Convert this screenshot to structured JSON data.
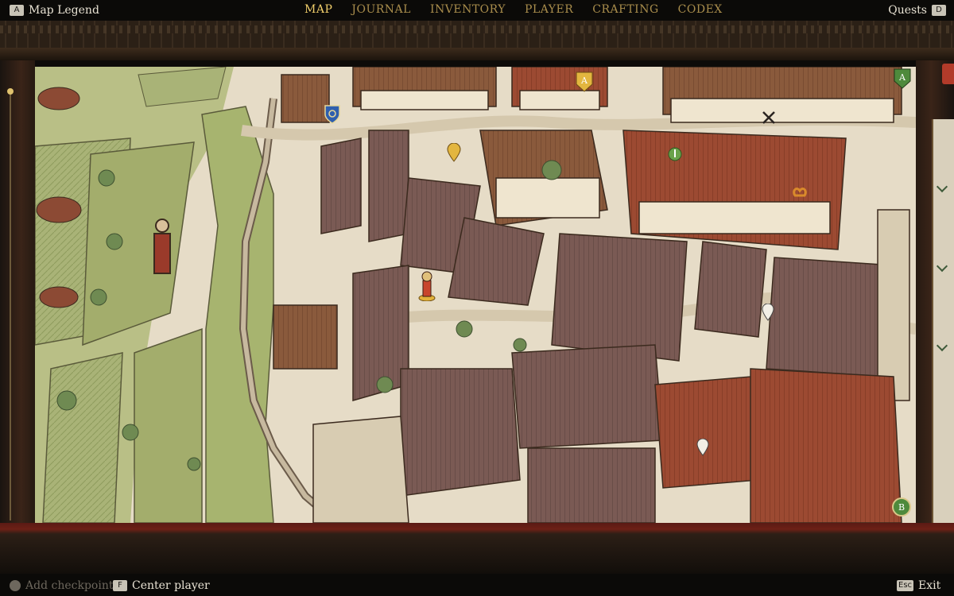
{
  "topbar": {
    "legend": {
      "key": "A",
      "label": "Map Legend"
    },
    "quests": {
      "key": "D",
      "label": "Quests"
    },
    "tabs": [
      {
        "label": "MAP",
        "active": true
      },
      {
        "label": "JOURNAL",
        "active": false
      },
      {
        "label": "INVENTORY",
        "active": false
      },
      {
        "label": "PLAYER",
        "active": false
      },
      {
        "label": "CRAFTING",
        "active": false
      },
      {
        "label": "CODEX",
        "active": false
      }
    ]
  },
  "map": {
    "icons": {
      "player": "player-marker-icon",
      "quest_a": "quest-marker-a-icon",
      "quest_b": "quest-marker-b-icon",
      "smithy": "crossed-hammers-icon",
      "shield": "blue-shield-icon",
      "bakery": "pretzel-icon"
    },
    "markers": {
      "quest_a_label": "A",
      "quest_b_label": "B"
    }
  },
  "bottombar": {
    "add_checkpoint": {
      "label": "Add checkpoint"
    },
    "center_player": {
      "key": "F",
      "label": "Center player"
    },
    "exit": {
      "key": "Esc",
      "label": "Exit"
    }
  },
  "colors": {
    "active_tab": "#f2cf6b",
    "inactive_tab": "#a98d4c",
    "parchment": "#e6dcc7",
    "roof": "#8a5a3c"
  }
}
